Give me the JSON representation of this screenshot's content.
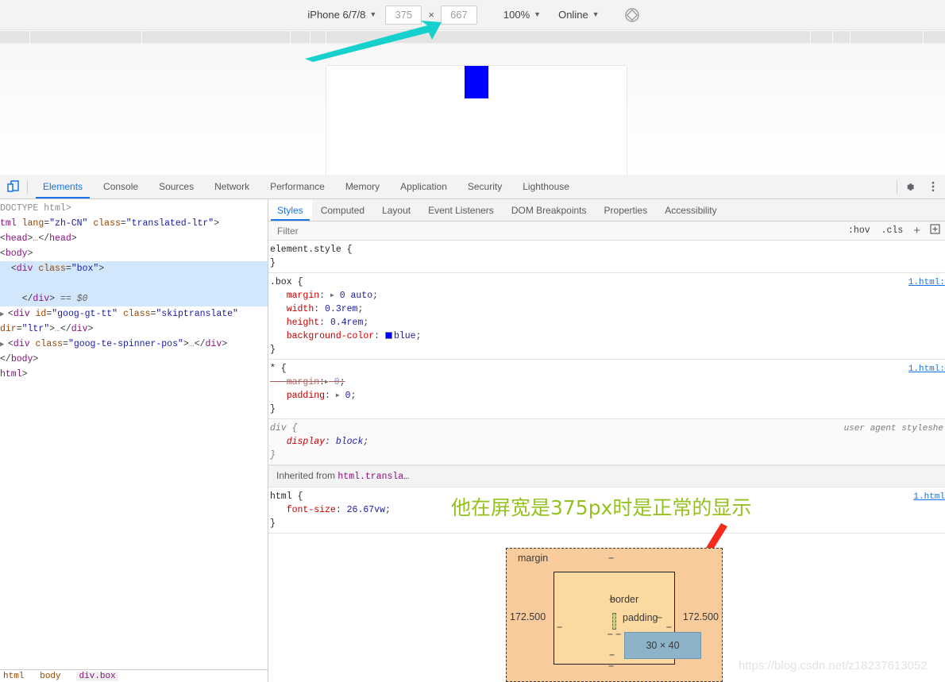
{
  "device_toolbar": {
    "device_name": "iPhone 6/7/8",
    "width_value": "375",
    "multiply_symbol": "×",
    "height_value": "667",
    "zoom_value": "100%",
    "network_value": "Online",
    "rotate_icon": "rotate-device-icon",
    "caret": "▼"
  },
  "preview": {
    "box_color": "#0000ff"
  },
  "devtools": {
    "inspect_icon": "device-toolbar-toggle-icon",
    "settings_icon": "gear-icon",
    "more_icon": "more-vertical-icon",
    "tabs": [
      {
        "label": "Elements",
        "active": true
      },
      {
        "label": "Console",
        "active": false
      },
      {
        "label": "Sources",
        "active": false
      },
      {
        "label": "Network",
        "active": false
      },
      {
        "label": "Performance",
        "active": false
      },
      {
        "label": "Memory",
        "active": false
      },
      {
        "label": "Application",
        "active": false
      },
      {
        "label": "Security",
        "active": false
      },
      {
        "label": "Lighthouse",
        "active": false
      }
    ]
  },
  "dom_tree": [
    {
      "html": "<span class=\"txtg\">DOCTYPE html&gt;</span>",
      "selected": false
    },
    {
      "html": "<span class=\"tag\">tml</span> <span class=\"attr\">lang</span><span class=\"punc\">=</span><span class=\"val\">\"zh-CN\"</span> <span class=\"attr\">class</span><span class=\"punc\">=</span><span class=\"val\">\"translated-ltr\"</span><span class=\"punc\">&gt;</span>",
      "selected": false
    },
    {
      "html": "<span class=\"punc\">&lt;</span><span class=\"tag\">head</span><span class=\"punc\">&gt;</span><span class=\"txtg\">…</span><span class=\"punc\">&lt;/</span><span class=\"tag\">head</span><span class=\"punc\">&gt;</span>",
      "selected": false
    },
    {
      "html": "<span class=\"punc\">&lt;</span><span class=\"tag\">body</span><span class=\"punc\">&gt;</span>",
      "selected": false
    },
    {
      "html": "  <span class=\"punc\">&lt;</span><span class=\"tag\">div</span> <span class=\"attr\">class</span><span class=\"punc\">=</span><span class=\"val\">\"box\"</span><span class=\"punc\">&gt;</span>",
      "selected": true
    },
    {
      "html": "",
      "selected": true
    },
    {
      "html": "    <span class=\"punc\">&lt;/</span><span class=\"tag\">div</span><span class=\"punc\">&gt;</span> <span class=\"dollar\">== $0</span>",
      "selected": true
    },
    {
      "html": "<span class=\"twisty\">▶</span><span class=\"punc\">&lt;</span><span class=\"tag\">div</span> <span class=\"attr\">id</span><span class=\"punc\">=</span><span class=\"val\">\"goog-gt-tt\"</span> <span class=\"attr\">class</span><span class=\"punc\">=</span><span class=\"val\">\"skiptranslate\"</span>",
      "selected": false
    },
    {
      "html": "<span class=\"attr\">dir</span><span class=\"punc\">=</span><span class=\"val\">\"ltr\"</span><span class=\"punc\">&gt;</span><span class=\"txtg\">…</span><span class=\"punc\">&lt;/</span><span class=\"tag\">div</span><span class=\"punc\">&gt;</span>",
      "selected": false
    },
    {
      "html": "<span class=\"twisty\">▶</span><span class=\"punc\">&lt;</span><span class=\"tag\">div</span> <span class=\"attr\">class</span><span class=\"punc\">=</span><span class=\"val\">\"goog-te-spinner-pos\"</span><span class=\"punc\">&gt;</span><span class=\"txtg\">…</span><span class=\"punc\">&lt;/</span><span class=\"tag\">div</span><span class=\"punc\">&gt;</span>",
      "selected": false
    },
    {
      "html": "<span class=\"punc\">&lt;/</span><span class=\"tag\">body</span><span class=\"punc\">&gt;</span>",
      "selected": false
    },
    {
      "html": "<span class=\"tag\">html</span><span class=\"punc\">&gt;</span>",
      "selected": false
    }
  ],
  "styles": {
    "tabs": [
      {
        "label": "Styles",
        "active": true
      },
      {
        "label": "Computed",
        "active": false
      },
      {
        "label": "Layout",
        "active": false
      },
      {
        "label": "Event Listeners",
        "active": false
      },
      {
        "label": "DOM Breakpoints",
        "active": false
      },
      {
        "label": "Properties",
        "active": false
      },
      {
        "label": "Accessibility",
        "active": false
      }
    ],
    "filter_placeholder": "Filter",
    "hov_label": ":hov",
    "cls_label": ".cls",
    "plus_label": "+",
    "new_style_icon": "new-stylesheet-icon",
    "rules": [
      {
        "selector": "element.style {",
        "close": "}",
        "source": "",
        "declarations": []
      },
      {
        "selector": ".box {",
        "close": "}",
        "source": "1.html:",
        "declarations": [
          {
            "prop": "margin",
            "value": "0 auto",
            "expand": true,
            "strike": false,
            "swatch": false
          },
          {
            "prop": "width",
            "value": "0.3rem",
            "expand": false,
            "strike": false,
            "swatch": false
          },
          {
            "prop": "height",
            "value": "0.4rem",
            "expand": false,
            "strike": false,
            "swatch": false
          },
          {
            "prop": "background-color",
            "value": "blue",
            "expand": false,
            "strike": false,
            "swatch": true,
            "swatch_color": "#0000ff"
          }
        ]
      },
      {
        "selector": "* {",
        "close": "}",
        "source": "1.html:",
        "declarations": [
          {
            "prop": "margin",
            "value": "0",
            "expand": true,
            "strike": true,
            "swatch": false
          },
          {
            "prop": "padding",
            "value": "0",
            "expand": true,
            "strike": false,
            "swatch": false
          }
        ]
      },
      {
        "selector": "div {",
        "close": "}",
        "source": "user agent styleshe",
        "ua": true,
        "declarations": [
          {
            "prop": "display",
            "value": "block",
            "expand": false,
            "strike": false,
            "swatch": false
          }
        ]
      }
    ],
    "inherited_label": "Inherited from",
    "inherited_from": "html.transla…",
    "html_rule": {
      "selector": "html {",
      "close": "}",
      "source": "1.html",
      "declarations": [
        {
          "prop": "font-size",
          "value": "26.67vw",
          "expand": false,
          "strike": false,
          "swatch": false
        }
      ]
    }
  },
  "annotation": {
    "text": "他在屏宽是375px时是正常的显示",
    "color": "#95c11f",
    "arrow_color": "#ff2a1f",
    "teal_arrow_color": "#15d0cc"
  },
  "box_model": {
    "margin_label": "margin",
    "border_label": "border",
    "padding_label": "padding",
    "content_size": "30 × 40",
    "dash": "−",
    "left_margin_value": "172.500",
    "right_margin_value": "172.500"
  },
  "watermark": "https://blog.csdn.net/z18237613052",
  "breadcrumb": {
    "items": [
      "html",
      "body",
      "div.box"
    ]
  }
}
